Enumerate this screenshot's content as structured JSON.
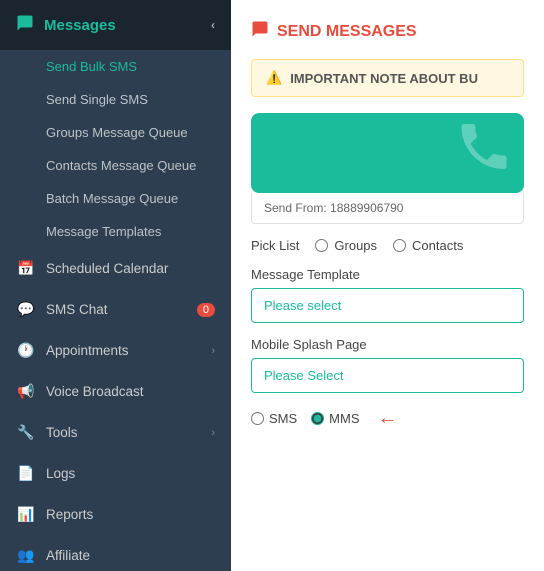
{
  "sidebar": {
    "messages_label": "Messages",
    "messages_chevron": "‹",
    "sub_items": [
      {
        "id": "send-bulk-sms",
        "label": "Send Bulk SMS",
        "active": true
      },
      {
        "id": "send-single-sms",
        "label": "Send Single SMS"
      },
      {
        "id": "groups-message-queue",
        "label": "Groups Message Queue"
      },
      {
        "id": "contacts-message-queue",
        "label": "Contacts Message Queue"
      },
      {
        "id": "batch-message-queue",
        "label": "Batch Message Queue"
      },
      {
        "id": "message-templates",
        "label": "Message Templates"
      }
    ],
    "nav_items": [
      {
        "id": "scheduled-calendar",
        "label": "Scheduled Calendar",
        "icon": "📅"
      },
      {
        "id": "sms-chat",
        "label": "SMS Chat",
        "icon": "💬",
        "badge": "0"
      },
      {
        "id": "appointments",
        "label": "Appointments",
        "icon": "🕐",
        "has_chevron": true
      },
      {
        "id": "voice-broadcast",
        "label": "Voice Broadcast",
        "icon": "📢"
      },
      {
        "id": "tools",
        "label": "Tools",
        "icon": "🔧",
        "has_chevron": true
      },
      {
        "id": "logs",
        "label": "Logs",
        "icon": "📄"
      },
      {
        "id": "reports",
        "label": "Reports",
        "icon": "📊"
      },
      {
        "id": "affiliate",
        "label": "Affiliate",
        "icon": "👥"
      }
    ]
  },
  "main": {
    "page_title": "SEND MESSAGES",
    "important_note_label": "IMPORTANT NOTE ABOUT BU",
    "send_from_label": "Send From:",
    "send_from_number": "18889906790",
    "pick_list_label": "Pick List",
    "groups_label": "Groups",
    "contacts_label": "Contacts",
    "message_template_label": "Message Template",
    "message_template_placeholder": "Please select",
    "mobile_splash_label": "Mobile Splash Page",
    "mobile_splash_placeholder": "Please Select",
    "sms_label": "SMS",
    "mms_label": "MMS"
  }
}
